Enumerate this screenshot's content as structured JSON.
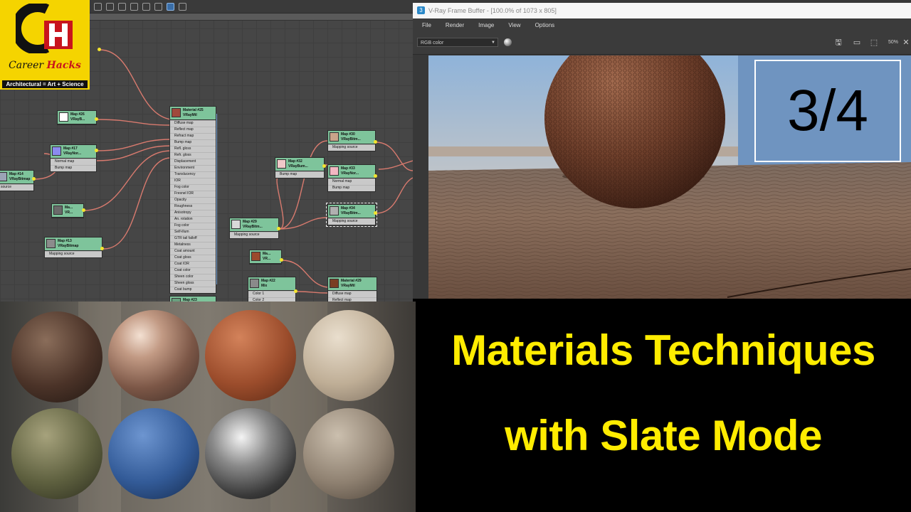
{
  "logo": {
    "initials": "CH",
    "word_career": "Career",
    "word_hacks": "Hacks",
    "tagline": "Architectural = Art + Science"
  },
  "slate": {
    "nodes": [
      {
        "id": "map14",
        "title": "Map #14",
        "type": "VRayBitmap",
        "slots": [
          "source"
        ]
      },
      {
        "id": "map26",
        "title": "Map #26",
        "type": "VRayB...",
        "slots": []
      },
      {
        "id": "map17",
        "title": "Map #17",
        "type": "VRayNor...",
        "slots": [
          "Normal map",
          "Bump map"
        ]
      },
      {
        "id": "mapA",
        "title": "Ma...",
        "type": "VR...",
        "slots": []
      },
      {
        "id": "map13",
        "title": "Map #13",
        "type": "VRayBitmap",
        "slots": [
          "Mapping source"
        ]
      },
      {
        "id": "material25",
        "title": "Material #25",
        "type": "VRayMtl",
        "slots": [
          "Diffuse map",
          "Reflect map",
          "Refract map",
          "Bump map",
          "Refl. gloss",
          "Refr. gloss",
          "Displacement",
          "Environment",
          "Translucency",
          "IOR",
          "Fog color",
          "Fresnel IOR",
          "Opacity",
          "Roughness",
          "Anisotropy",
          "An. rotation",
          "Fog color",
          "Self-illum",
          "GTR tail falloff",
          "Metalness",
          "Coat amount",
          "Coat gloss",
          "Coat IOR",
          "Coat color",
          "Sheen color",
          "Sheen gloss",
          "Coat bump"
        ]
      },
      {
        "id": "map23",
        "title": "Map #23",
        "type": "",
        "slots": []
      },
      {
        "id": "map29",
        "title": "Map #29",
        "type": "VRayBitm...",
        "slots": [
          "Mapping source"
        ]
      },
      {
        "id": "map32",
        "title": "Map #32",
        "type": "VRayBum...",
        "slots": [
          "Bump map"
        ]
      },
      {
        "id": "map30",
        "title": "Map #30",
        "type": "VRayBitm...",
        "slots": [
          "Mapping source"
        ]
      },
      {
        "id": "map33",
        "title": "Map #33",
        "type": "VRayNor...",
        "slots": [
          "Normal map",
          "Bump map"
        ]
      },
      {
        "id": "map34",
        "title": "Map #34",
        "type": "VRayBitm...",
        "slots": [
          "Mapping source"
        ]
      },
      {
        "id": "mapB",
        "title": "Ma...",
        "type": "VR...",
        "slots": []
      },
      {
        "id": "map22",
        "title": "Map #22",
        "type": "Mix",
        "slots": [
          "Color 1",
          "Color 2"
        ]
      },
      {
        "id": "material29",
        "title": "Material #29",
        "type": "VRayMtl",
        "slots": [
          "Diffuse map",
          "Reflect map"
        ]
      }
    ]
  },
  "vfb": {
    "title": "V-Ray Frame Buffer - [100.0% of 1073 x 805]",
    "menu": [
      "File",
      "Render",
      "Image",
      "View",
      "Options"
    ],
    "channel": "RGB color",
    "zoom_label": "50%",
    "counter": "3/4"
  },
  "headline": {
    "line1": "Materials Techniques",
    "line2": "with Slate Mode"
  },
  "colors": {
    "accent_yellow": "#ffec00",
    "logo_yellow": "#f5d400",
    "node_header": "#7ec49b",
    "wire": "#d87a6e",
    "socket": "#f3e32d"
  },
  "icons": [
    "save-icon",
    "copy-icon",
    "region-select-icon",
    "close-icon",
    "sphere-icon",
    "dropdown-arrow-icon"
  ]
}
